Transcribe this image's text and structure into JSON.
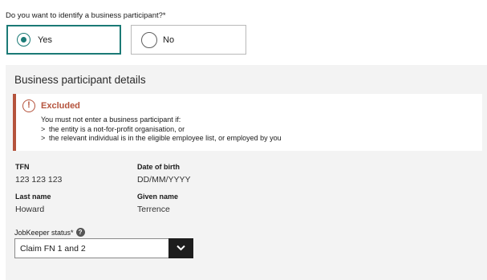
{
  "question": {
    "label": "Do you want to identify a business participant?*",
    "options": [
      {
        "label": "Yes",
        "selected": true
      },
      {
        "label": "No",
        "selected": false
      }
    ]
  },
  "panel": {
    "title": "Business participant details",
    "alert": {
      "icon": "exclamation-circle-icon",
      "title": "Excluded",
      "intro": "You must not enter a business participant if:",
      "items": [
        "the entity is a not-for-profit organisation, or",
        "the relevant individual is in the eligible employee list, or employed by you"
      ],
      "bullet": ">"
    },
    "fields": {
      "tfn": {
        "label": "TFN",
        "value": "123 123 123"
      },
      "dob": {
        "label": "Date of birth",
        "value": "DD/MM/YYYY"
      },
      "last_name": {
        "label": "Last name",
        "value": "Howard"
      },
      "given_name": {
        "label": "Given name",
        "value": "Terrence"
      }
    },
    "status": {
      "label": "JobKeeper status*",
      "help": "?",
      "value": "Claim FN 1 and 2"
    }
  },
  "colors": {
    "accent": "#1b7a76",
    "warning": "#b5533c",
    "panel_bg": "#f3f3f3"
  }
}
